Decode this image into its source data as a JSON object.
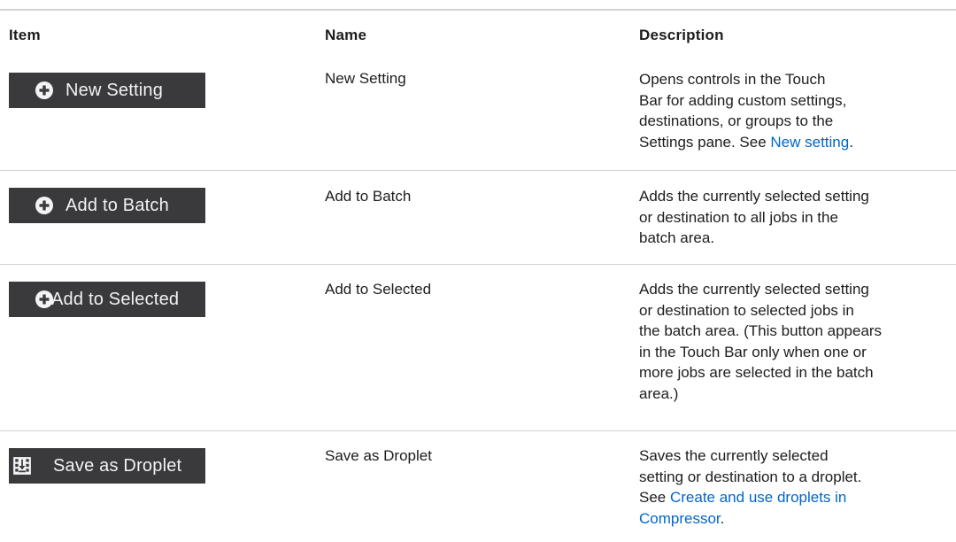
{
  "headers": {
    "item": "Item",
    "name": "Name",
    "description": "Description"
  },
  "rows": [
    {
      "button_label": "New Setting",
      "icon": "plus-circle-icon",
      "name": "New Setting",
      "desc_lines": [
        "Opens controls in the Touch",
        "Bar for adding custom settings,",
        "destinations, or groups to the"
      ],
      "desc_last_prefix": "Settings pane. See ",
      "desc_link": "New setting",
      "desc_last_suffix": "."
    },
    {
      "button_label": "Add to Batch",
      "icon": "plus-circle-icon",
      "name": "Add to Batch",
      "desc_lines": [
        "Adds the currently selected setting",
        "or destination to all jobs in the",
        "batch area."
      ]
    },
    {
      "button_label": "Add to Selected",
      "icon": "plus-circle-icon",
      "name": "Add to Selected",
      "desc_lines": [
        "Adds the currently selected setting",
        "or destination to selected jobs in",
        "the batch area. (This button appears",
        "in the Touch Bar only when one or",
        "more jobs are selected in the batch",
        "area.)"
      ]
    },
    {
      "button_label": "Save as Droplet",
      "icon": "droplet-save-icon",
      "name": "Save as Droplet",
      "desc_lines": [
        "Saves the currently selected",
        "setting or destination to a droplet."
      ],
      "desc_l3_prefix": "See ",
      "desc_link_a": "Create and use droplets in",
      "desc_link_b": "Compressor",
      "desc_link_suffix": "."
    }
  ],
  "colors": {
    "button_bg": "#3a3a3c",
    "link": "#0066cc",
    "rule": "#d2d2d7"
  }
}
